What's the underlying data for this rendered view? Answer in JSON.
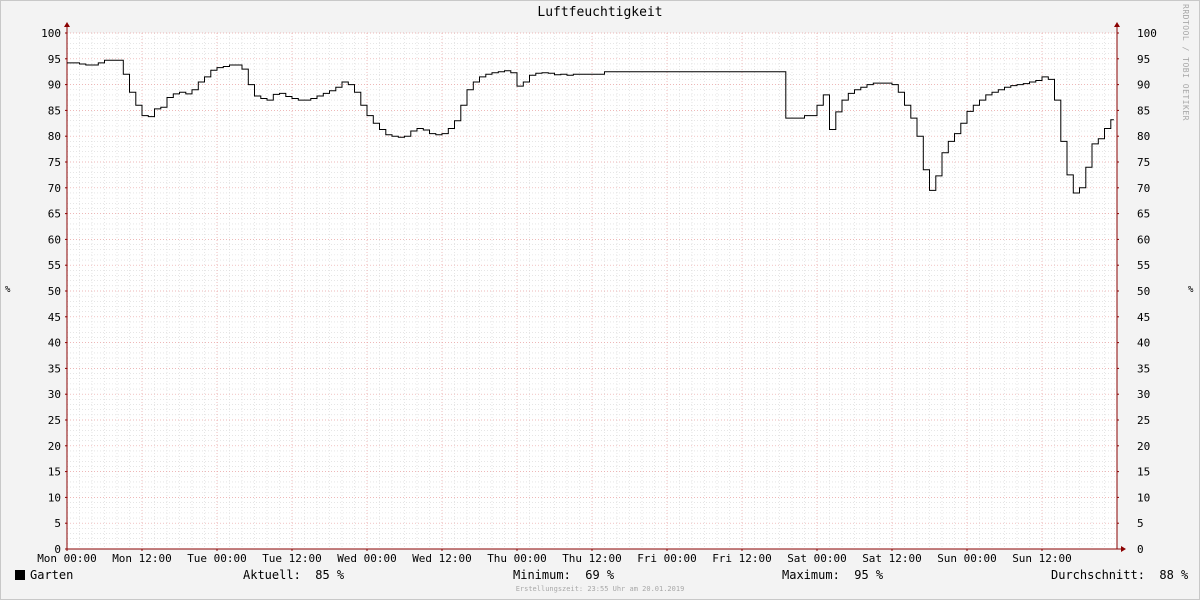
{
  "chart_data": {
    "type": "line",
    "title": "Luftfeuchtigkeit",
    "ylabel": "%",
    "ylim": [
      0,
      100
    ],
    "yticks": [
      0,
      5,
      10,
      15,
      20,
      25,
      30,
      35,
      40,
      45,
      50,
      55,
      60,
      65,
      70,
      75,
      80,
      85,
      90,
      95,
      100
    ],
    "xticks": [
      "Mon 00:00",
      "Mon 12:00",
      "Tue 00:00",
      "Tue 12:00",
      "Wed 00:00",
      "Wed 12:00",
      "Thu 00:00",
      "Thu 12:00",
      "Fri 00:00",
      "Fri 12:00",
      "Sat 00:00",
      "Sat 12:00",
      "Sun 00:00",
      "Sun 12:00"
    ],
    "xlim_hours": [
      0,
      168
    ],
    "grid": true,
    "series": [
      {
        "name": "Garten",
        "color": "#000000",
        "step": true,
        "x_hours": [
          0,
          2,
          3,
          4,
          5,
          6,
          7,
          8,
          9,
          10,
          11,
          12,
          13,
          14,
          15,
          16,
          17,
          18,
          19,
          20,
          21,
          22,
          23,
          24,
          25,
          26,
          27,
          28,
          29,
          30,
          31,
          32,
          33,
          34,
          35,
          36,
          37,
          38,
          39,
          40,
          41,
          42,
          43,
          44,
          45,
          46,
          47,
          48,
          49,
          50,
          51,
          52,
          53,
          54,
          55,
          56,
          57,
          58,
          59,
          60,
          61,
          62,
          63,
          64,
          65,
          66,
          67,
          68,
          69,
          70,
          71,
          72,
          73,
          74,
          75,
          76,
          77,
          78,
          79,
          80,
          81,
          82,
          83,
          84,
          85,
          86,
          87,
          88,
          90,
          92,
          94,
          96,
          98,
          100,
          103,
          106,
          109,
          112,
          115,
          118,
          120,
          121,
          122,
          123,
          124,
          125,
          126,
          127,
          128,
          129,
          130,
          131,
          132,
          133,
          134,
          135,
          136,
          137,
          138,
          139,
          140,
          141,
          142,
          143,
          144,
          145,
          146,
          147,
          148,
          149,
          150,
          151,
          152,
          153,
          154,
          155,
          156,
          157,
          158,
          159,
          160,
          161,
          162,
          163,
          164,
          165,
          166,
          167
        ],
        "values": [
          94.2,
          94,
          93.8,
          93.8,
          94.2,
          94.7,
          94.7,
          94.7,
          92,
          88.5,
          86,
          84,
          83.8,
          85.3,
          85.6,
          87.5,
          88.2,
          88.5,
          88.2,
          89,
          90.5,
          91.5,
          92.8,
          93.3,
          93.5,
          93.8,
          93.8,
          93,
          90,
          87.8,
          87.3,
          87,
          88.1,
          88.3,
          87.7,
          87.3,
          87,
          87,
          87.3,
          87.8,
          88.3,
          88.8,
          89.5,
          90.5,
          90,
          88.5,
          86,
          84,
          82.5,
          81.3,
          80.3,
          80,
          79.8,
          80,
          81,
          81.5,
          81.2,
          80.5,
          80.3,
          80.5,
          81.5,
          83,
          86,
          89,
          90.5,
          91.5,
          92,
          92.3,
          92.5,
          92.7,
          92.3,
          89.7,
          90.5,
          91.8,
          92.2,
          92.3,
          92.2,
          91.9,
          92,
          91.8,
          92,
          92,
          92,
          92,
          92,
          92.5,
          92.5,
          92.5,
          92.5,
          92.5,
          92.5,
          92.5,
          92.5,
          92.5,
          92.5,
          92.5,
          92.5,
          92.5,
          83.5,
          84,
          86,
          88,
          81.3,
          84.7,
          87,
          88.3,
          89,
          89.5,
          90,
          90.3,
          90.3,
          90.3,
          90,
          88.5,
          86,
          83.5,
          80,
          73.5,
          69.5,
          72.3,
          76.8,
          79,
          80.5,
          82.5,
          84.8,
          86,
          87,
          88,
          88.5,
          89,
          89.5,
          89.8,
          90,
          90.2,
          90.5,
          90.8,
          91.5,
          91,
          87,
          79,
          72.5,
          69,
          70,
          74,
          78.5,
          79.5,
          81.5,
          83.2,
          84.7
        ]
      }
    ]
  },
  "watermark": "RRDTOOL / TOBI OETIKER",
  "legend": {
    "series_name": "Garten",
    "current_label": "Aktuell:",
    "current_value": "85 %",
    "min_label": "Minimum:",
    "min_value": "69 %",
    "max_label": "Maximum:",
    "max_value": "95 %",
    "avg_label": "Durchschnitt:",
    "avg_value": "88 %"
  },
  "footer": "Erstellungszeit: 23:55 Uhr am 20.01.2019",
  "colors": {
    "plot_bg": "#ffffff",
    "major_grid": "#e8a0a0",
    "minor_grid": "#d6d6d6",
    "axis": "#8a0000",
    "line": "#000000"
  }
}
